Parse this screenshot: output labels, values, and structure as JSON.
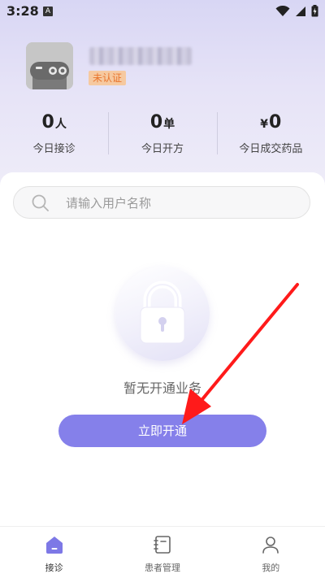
{
  "status_bar": {
    "time": "3:28",
    "notification_letter": "A"
  },
  "profile": {
    "verify_badge": "未认证"
  },
  "stats": [
    {
      "value": "0",
      "unit": "人",
      "prefix": "",
      "label": "今日接诊"
    },
    {
      "value": "0",
      "unit": "单",
      "prefix": "",
      "label": "今日开方"
    },
    {
      "value": "0",
      "unit": "",
      "prefix": "¥",
      "label": "今日成交药品"
    }
  ],
  "search": {
    "placeholder": "请输入用户名称",
    "value": ""
  },
  "empty_state": {
    "message": "暂无开通业务",
    "button_label": "立即开通"
  },
  "tabs": [
    {
      "label": "接诊",
      "icon": "home-icon",
      "active": true
    },
    {
      "label": "患者管理",
      "icon": "notebook-icon",
      "active": false
    },
    {
      "label": "我的",
      "icon": "person-icon",
      "active": false
    }
  ],
  "colors": {
    "accent": "#8580ea",
    "badge_text": "#e8742d",
    "badge_bg": "#f6c9a0",
    "arrow": "#ff1a1a"
  }
}
